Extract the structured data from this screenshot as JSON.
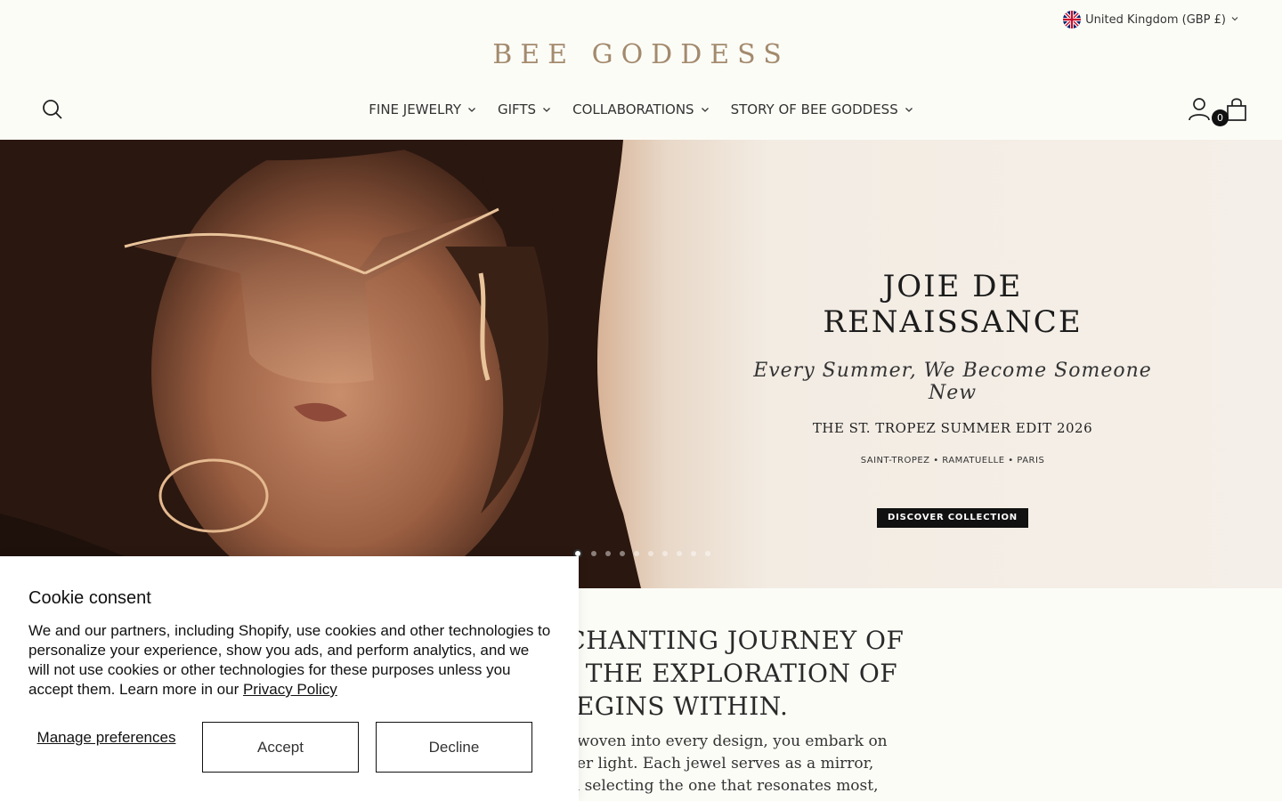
{
  "header": {
    "country_selector": "United Kingdom (GBP £)",
    "logo": "BEE GODDESS",
    "nav": [
      {
        "label": "FINE JEWELRY"
      },
      {
        "label": "GIFTS"
      },
      {
        "label": "COLLABORATIONS"
      },
      {
        "label": "STORY OF BEE GODDESS"
      }
    ],
    "cart_count": "0"
  },
  "hero": {
    "title": "JOIE DE\nRENAISSANCE",
    "script": "Every Summer, We Become Someone New",
    "edit": "THE ST. TROPEZ SUMMER EDIT 2026",
    "places": "SAINT-TROPEZ  •  RAMATUELLE  •  PARIS",
    "cta": "DISCOVER COLLECTION",
    "slide_count": 10,
    "active_slide": 1
  },
  "story": {
    "heading": "E ENCHANTING JOURNEY OF\nHERE THE EXPLORATION OF\nGIC BEGINS WITHIN.",
    "body": "ymbolism woven into every design, you embark on\ng your inner light. Each jewel serves as a mirror,\noul, and in selecting the one that resonates most,"
  },
  "cookie": {
    "title": "Cookie consent",
    "text": "We and our partners, including Shopify, use cookies and other technologies to personalize your experience, show you ads, and perform analytics, and we will not use cookies or other technologies for these purposes unless you accept them. Learn more in our ",
    "link": "Privacy Policy",
    "manage": "Manage preferences",
    "accept": "Accept",
    "decline": "Decline"
  },
  "colors": {
    "background": "#fcfcf7",
    "logo": "#a38a6d",
    "cta": "#111111"
  }
}
